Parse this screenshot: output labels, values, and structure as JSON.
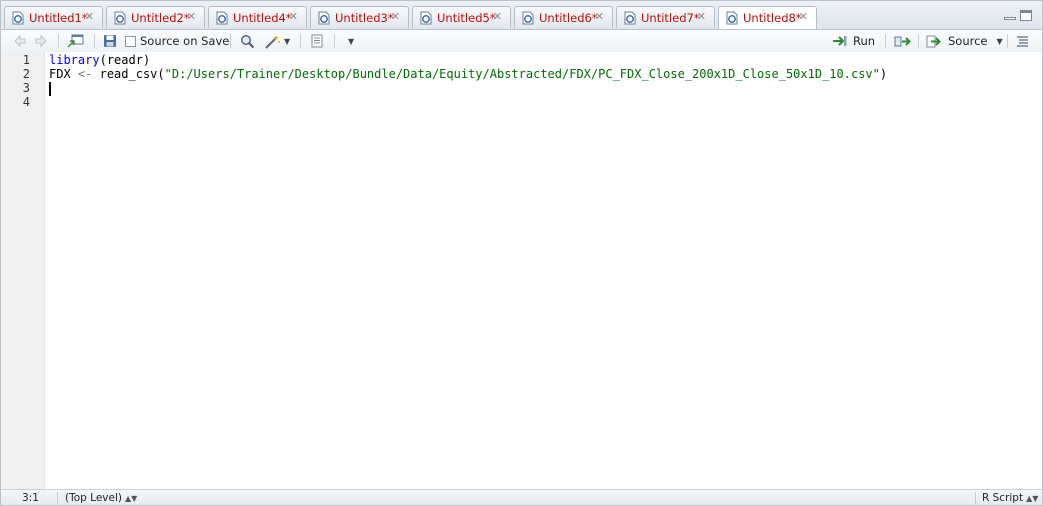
{
  "tabs": [
    {
      "label": "Untitled1*",
      "active": false
    },
    {
      "label": "Untitled2*",
      "active": false
    },
    {
      "label": "Untitled4*",
      "active": false
    },
    {
      "label": "Untitled3*",
      "active": false
    },
    {
      "label": "Untitled5*",
      "active": false
    },
    {
      "label": "Untitled6*",
      "active": false
    },
    {
      "label": "Untitled7*",
      "active": false
    },
    {
      "label": "Untitled8*",
      "active": true
    }
  ],
  "toolbar": {
    "source_on_save_label": "Source on Save",
    "run_label": "Run",
    "source_label": "Source"
  },
  "editor": {
    "line_numbers": [
      "1",
      "2",
      "3",
      "4"
    ],
    "lines": {
      "l1": {
        "fn": "library",
        "open": "(",
        "arg": "readr",
        "close": ")"
      },
      "l2": {
        "var": "FDX",
        "assign": "<-",
        "fn": "read_csv",
        "open": "(",
        "path": "\"D:/Users/Trainer/Desktop/Bundle/Data/Equity/Abstracted/FDX/PC_FDX_Close_200x1D_Close_50x1D_10.csv\"",
        "close": ")"
      }
    }
  },
  "status": {
    "position": "3:1",
    "scope": "(Top Level)",
    "file_type": "R Script"
  },
  "colors": {
    "tab_text": "#b80f0f",
    "keyword": "#0000ff",
    "string": "#036a07",
    "operator": "#687687"
  },
  "icons": {
    "tab": "r-document-icon",
    "back": "back-arrow-icon",
    "forward": "forward-arrow-icon",
    "show_in_window": "show-in-new-window-icon",
    "save": "save-icon",
    "search": "search-icon",
    "code_tools": "magic-wand-icon",
    "compile": "notebook-icon",
    "run": "run-arrow-icon",
    "rerun": "rerun-icon",
    "source": "source-icon",
    "outline": "outline-icon"
  }
}
